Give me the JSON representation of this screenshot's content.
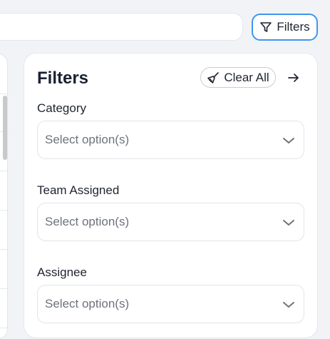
{
  "toolbar": {
    "filters_button_label": "Filters",
    "filters_icon": "funnel-icon",
    "accent_color": "#3c97ef"
  },
  "filters_panel": {
    "title": "Filters",
    "clear_all_label": "Clear All",
    "clear_all_icon": "broom-icon",
    "close_icon": "arrow-right-icon",
    "fields": [
      {
        "label": "Category",
        "placeholder": "Select option(s)"
      },
      {
        "label": "Team Assigned",
        "placeholder": "Select option(s)"
      },
      {
        "label": "Assignee",
        "placeholder": "Select option(s)"
      }
    ]
  }
}
